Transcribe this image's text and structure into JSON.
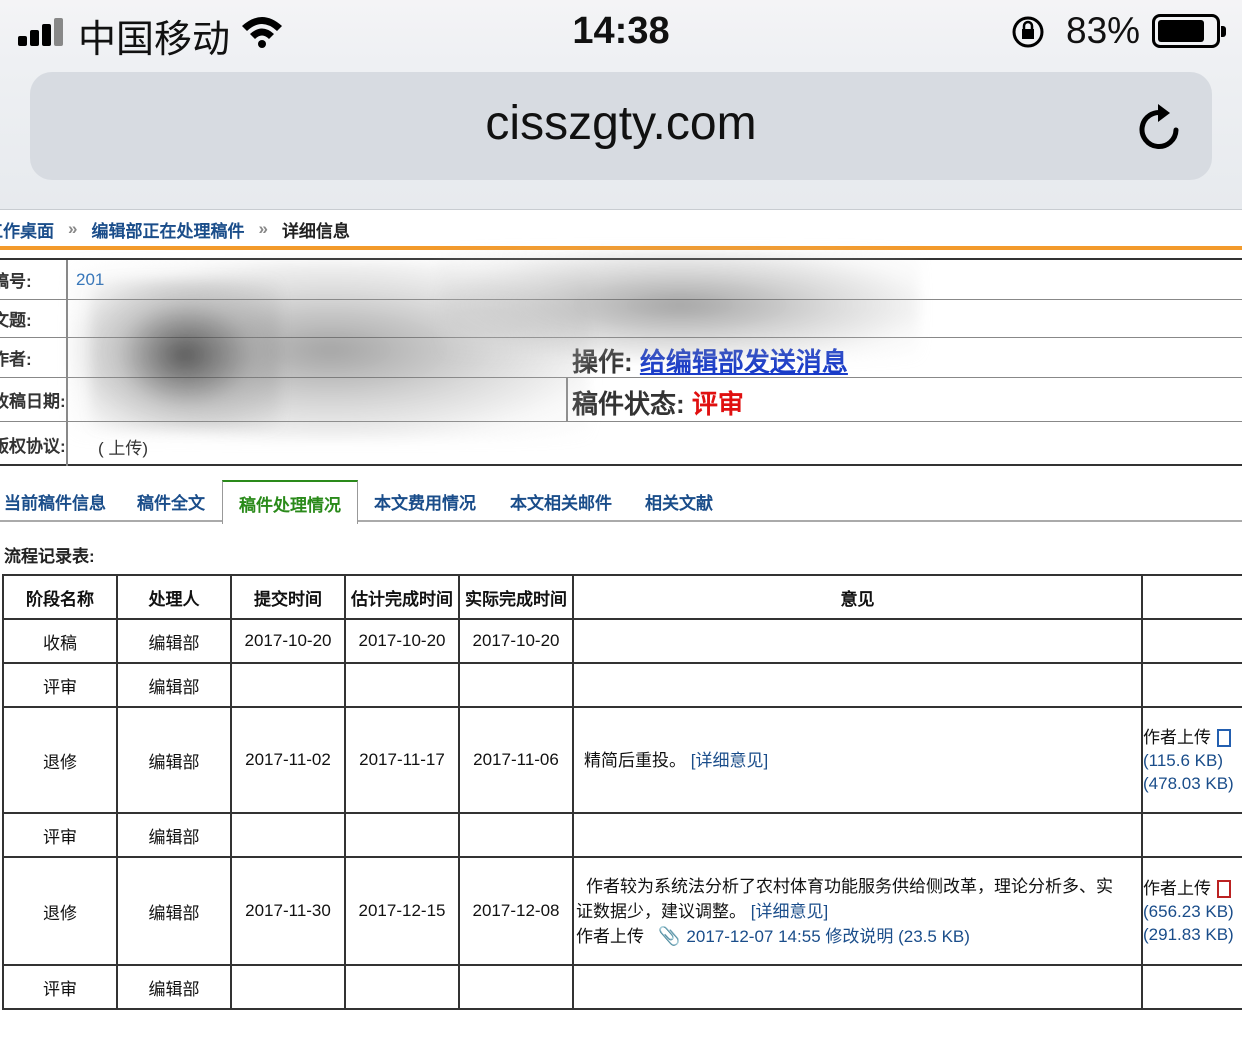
{
  "status_bar": {
    "carrier": "中国移动",
    "time": "14:38",
    "battery_pct": "83%"
  },
  "browser": {
    "url": "cisszgty.com"
  },
  "breadcrumb": {
    "items": [
      "工作桌面",
      "编辑部正在处理稿件"
    ],
    "current": "详细信息"
  },
  "info": {
    "labels": [
      "稿号:",
      "文题:",
      "作者:",
      "收稿日期:",
      "版权协议:"
    ],
    "manuscript_no_partial": "201",
    "upload_link": "( 上传)",
    "op_label": "操作: ",
    "op_link": "给编辑部发送消息",
    "status_label": "稿件状态: ",
    "status_value": "评审"
  },
  "tabs": [
    "当前稿件信息",
    "稿件全文",
    "稿件处理情况",
    "本文费用情况",
    "本文相关邮件",
    "相关文献"
  ],
  "flow": {
    "title": "流程记录表:",
    "headers": [
      "阶段名称",
      "处理人",
      "提交时间",
      "估计完成时间",
      "实际完成时间",
      "意见",
      ""
    ],
    "rows": [
      {
        "stage": "收稿",
        "handler": "编辑部",
        "submit": "2017-10-20",
        "est": "2017-10-20",
        "actual": "2017-10-20"
      },
      {
        "stage": "评审",
        "handler": "编辑部",
        "submit": "",
        "est": "",
        "actual": ""
      },
      {
        "stage": "退修",
        "handler": "编辑部",
        "submit": "2017-11-02",
        "est": "2017-11-17",
        "actual": "2017-11-06",
        "opinion": "精简后重投。",
        "detail_link": "[详细意见]",
        "att_label": "作者上传",
        "att_size1": "(115.6 KB)",
        "att_size2": "(478.03 KB)"
      },
      {
        "stage": "评审",
        "handler": "编辑部",
        "submit": "",
        "est": "",
        "actual": ""
      },
      {
        "stage": "退修",
        "handler": "编辑部",
        "submit": "2017-11-30",
        "est": "2017-12-15",
        "actual": "2017-12-08",
        "opinion_line1": "作者较为系统法分析了农村体育功能服务供给侧改革，理论分析多、实",
        "opinion_line2": "证数据少，建议调整。",
        "detail_link": "[详细意见]",
        "upload_label": "作者上传",
        "upload_file": "2017-12-07 14:55 修改说明 (23.5 KB)",
        "att_label": "作者上传",
        "att_size1": "(656.23 KB)",
        "att_size2": "(291.83 KB)"
      },
      {
        "stage": "评审",
        "handler": "编辑部",
        "submit": "",
        "est": "",
        "actual": ""
      }
    ]
  }
}
